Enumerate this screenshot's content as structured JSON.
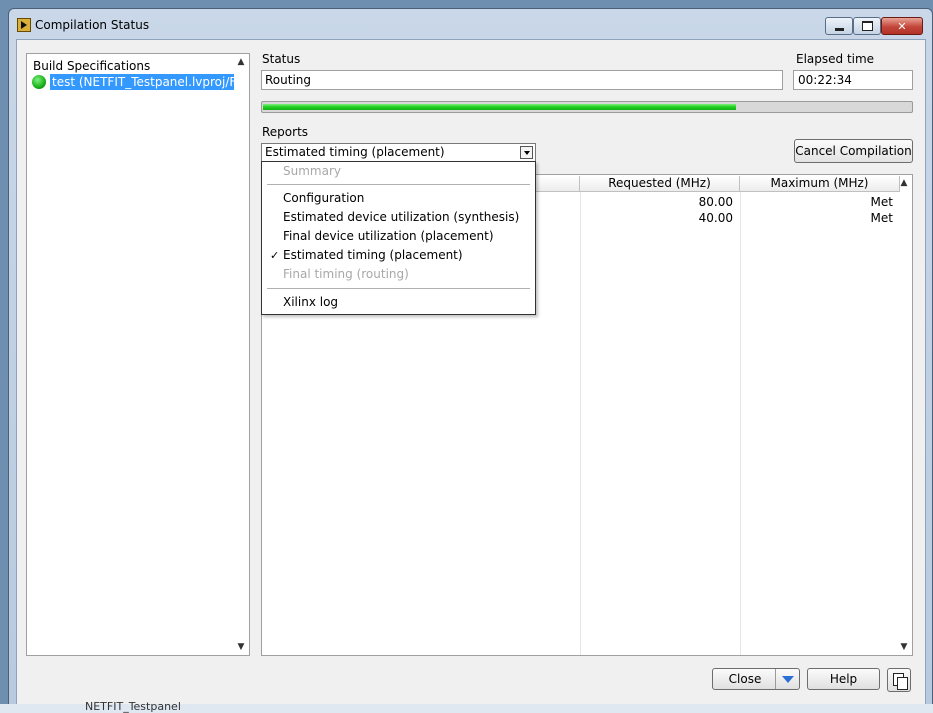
{
  "window": {
    "title": "Compilation Status"
  },
  "build_specifications": {
    "header": "Build Specifications",
    "items": [
      {
        "label": "test (NETFIT_Testpanel.lvproj/FPGA Target)",
        "status": "success",
        "selected": true
      }
    ]
  },
  "status": {
    "label": "Status",
    "value": "Routing"
  },
  "elapsed": {
    "label": "Elapsed time",
    "value": "00:22:34"
  },
  "progress": {
    "fraction": 0.73,
    "color": "#1ecf1e"
  },
  "reports": {
    "label": "Reports",
    "selected": "Estimated timing (placement)",
    "menu": [
      {
        "label": "Summary",
        "enabled": false,
        "checked": false
      },
      {
        "separator": true
      },
      {
        "label": "Configuration",
        "enabled": true,
        "checked": false
      },
      {
        "label": "Estimated device utilization (synthesis)",
        "enabled": true,
        "checked": false
      },
      {
        "label": "Final device utilization (placement)",
        "enabled": true,
        "checked": false
      },
      {
        "label": "Estimated timing (placement)",
        "enabled": true,
        "checked": true
      },
      {
        "label": "Final timing (routing)",
        "enabled": false,
        "checked": false
      },
      {
        "separator": true
      },
      {
        "label": "Xilinx log",
        "enabled": true,
        "checked": false
      }
    ],
    "check_glyph": "✓"
  },
  "cancel_button": {
    "label": "Cancel Compilation"
  },
  "report_table": {
    "columns": [
      "",
      "Requested (MHz)",
      "Maximum (MHz)"
    ],
    "rows": [
      {
        "requested": "80.00",
        "maximum": "Met"
      },
      {
        "requested": "40.00",
        "maximum": "Met"
      }
    ]
  },
  "buttons": {
    "close": "Close",
    "help": "Help"
  },
  "taskbar": {
    "text": "NETFIT_Testpanel"
  }
}
